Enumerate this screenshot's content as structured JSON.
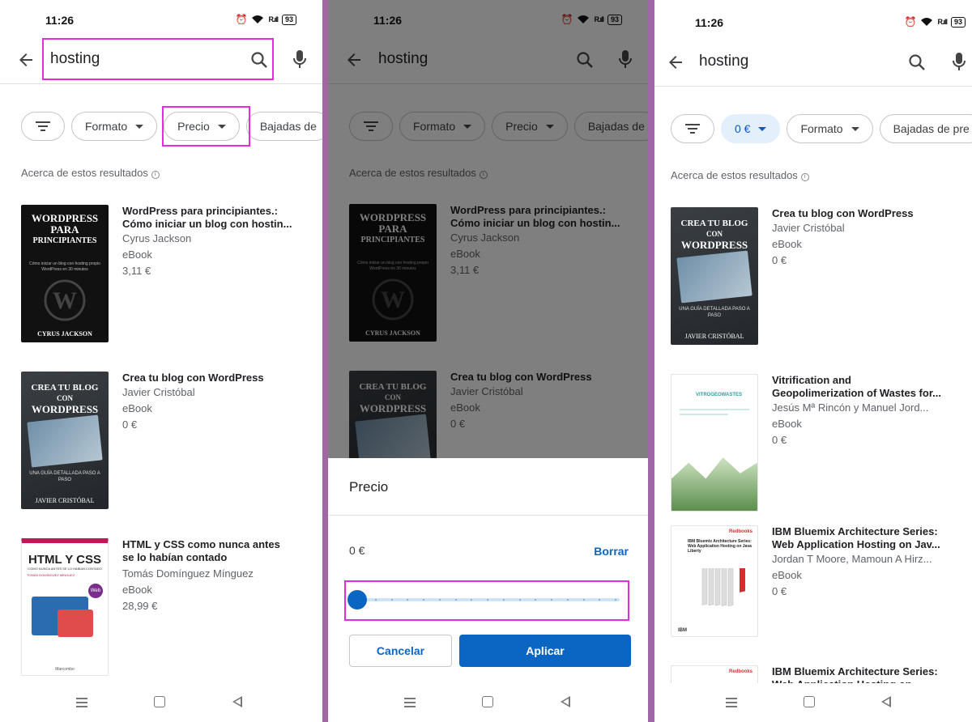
{
  "status": {
    "time": "11:26",
    "battery": "93",
    "signal": "R.ıll"
  },
  "search": {
    "query": "hosting"
  },
  "chips": {
    "formato": "Formato",
    "precio": "Precio",
    "bajadas_p1": "Bajadas de",
    "bajadas_p3": "Bajadas de pre",
    "price_selected": "0 €"
  },
  "about": "Acerca de estos resultados",
  "results_left": [
    {
      "title": "WordPress para principiantes.: Cómo iniciar un blog con hostin...",
      "author": "Cyrus Jackson",
      "format": "eBook",
      "price": "3,11 €",
      "cover": {
        "line1": "WORDPRESS",
        "line2": "PARA",
        "line3": "PRINCIPIANTES",
        "sub": "Cómo iniciar un blog con hosting propio WordPress en 30 minutos",
        "author": "CYRUS JACKSON"
      }
    },
    {
      "title": "Crea tu blog con WordPress",
      "author": "Javier Cristóbal",
      "format": "eBook",
      "price": "0 €",
      "cover": {
        "line1": "CREA TU BLOG",
        "line2": "CON",
        "line3": "WORDPRESS",
        "sub": "UNA GUÍA DETALLADA PASO A PASO",
        "author": "JAVIER CRISTÓBAL"
      }
    },
    {
      "title": "HTML y CSS como nunca antes se lo habían contado",
      "author": "Tomás Domínguez Mínguez",
      "format": "eBook",
      "price": "28,99 €",
      "cover": {
        "line1": "HTML Y CSS",
        "line2": "COMO NUNCA ANTES SE LO HABÍAN CONTADO",
        "line3": "TOMÁS DOMÍNGUEZ MÍNGUEZ",
        "sub": "Web",
        "author": "Marcombo"
      }
    }
  ],
  "results_right": [
    {
      "title": "Crea tu blog con WordPress",
      "author": "Javier Cristóbal",
      "format": "eBook",
      "price": "0 €"
    },
    {
      "title": "Vitrification and Geopolimerization of Wastes for...",
      "author": "Jesús Mª Rincón y Manuel Jord...",
      "format": "eBook",
      "price": "0 €",
      "cover": {
        "head": "VITROGEOWASTES"
      }
    },
    {
      "title": "IBM Bluemix Architecture Series: Web Application Hosting on Jav...",
      "author": "Jordan T Moore, Mamoun A Hirz...",
      "format": "eBook",
      "price": "0 €",
      "cover": {
        "brand": "Redbooks",
        "text": "IBM Bluemix Architecture Series: Web Application Hosting on Java Liberty",
        "ibm": "IBM"
      }
    },
    {
      "title": "IBM Bluemix Architecture Series: Web Application Hosting on IBM...",
      "author": "",
      "format": "",
      "price": "",
      "cover": {
        "brand": "Redbooks"
      }
    }
  ],
  "sheet": {
    "title": "Precio",
    "value": "0 €",
    "clear": "Borrar",
    "cancel": "Cancelar",
    "apply": "Aplicar",
    "slider_value": 0
  },
  "colors": {
    "accent": "#0b66c3",
    "highlight": "#e52be0",
    "divider": "#a066a6"
  }
}
